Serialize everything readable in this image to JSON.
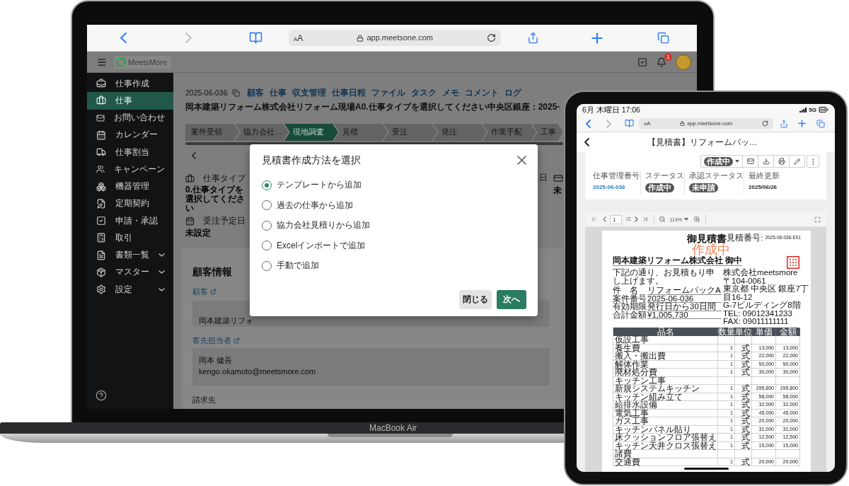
{
  "laptop": {
    "model_label": "MacBook Air",
    "browser": {
      "text_size": "AA",
      "url": "app.meetsone.com"
    },
    "app_header": {
      "logo": "MeetsMore",
      "notification_count": "1"
    },
    "sidebar": {
      "items": [
        {
          "label": "仕事作成",
          "selected": false,
          "expandable": false
        },
        {
          "label": "仕事",
          "selected": true,
          "expandable": false
        },
        {
          "label": "お問い合わせ",
          "selected": false,
          "expandable": false
        },
        {
          "label": "カレンダー",
          "selected": false,
          "expandable": false
        },
        {
          "label": "仕事割当",
          "selected": false,
          "expandable": false
        },
        {
          "label": "キャンペーン",
          "selected": false,
          "expandable": false
        },
        {
          "label": "機器管理",
          "selected": false,
          "expandable": false
        },
        {
          "label": "定期契約",
          "selected": false,
          "expandable": false
        },
        {
          "label": "申請・承認",
          "selected": false,
          "expandable": false
        },
        {
          "label": "取引",
          "selected": false,
          "expandable": false
        },
        {
          "label": "書類一覧",
          "selected": false,
          "expandable": true
        },
        {
          "label": "マスター",
          "selected": false,
          "expandable": true
        },
        {
          "label": "設定",
          "selected": false,
          "expandable": true
        }
      ]
    },
    "job": {
      "number": "2025-06-036",
      "links": [
        "顧客",
        "仕事",
        "収支管理",
        "仕事日程",
        "ファイル",
        "タスク",
        "メモ",
        "コメント",
        "ログ"
      ],
      "title": "岡本建築リフォーム株式会社リフォーム現場A0.仕事タイプを選択してください中央区銀座：2025-",
      "steps": [
        {
          "label": "案件受領",
          "selected": false
        },
        {
          "label": "協力会社…",
          "selected": false
        },
        {
          "label": "現地調査",
          "selected": true
        },
        {
          "label": "見積",
          "selected": false
        },
        {
          "label": "受注",
          "selected": false
        },
        {
          "label": "発注",
          "selected": false
        },
        {
          "label": "作業手配",
          "selected": false
        },
        {
          "label": "工事",
          "selected": false
        }
      ],
      "fields": [
        {
          "label": "仕事タイプ",
          "value": "0.仕事タイプを選択してください"
        },
        {
          "label": "受注予定日",
          "value": "未設定"
        }
      ],
      "column_3": {
        "label": "日"
      },
      "column_4": {
        "value": "未"
      }
    },
    "customer_panel": {
      "heading": "顧客情報",
      "customer_label": "顧客",
      "customer_value": "岡本建築リフォ",
      "contact_label": "客先担当者",
      "contact_name": "岡本 健吾",
      "contact_email": "kengo.okamoto@meetsmore.com",
      "billing_label": "請求先"
    },
    "dialog": {
      "title": "見積書作成方法を選択",
      "options": [
        {
          "label": "テンプレートから追加",
          "selected": true
        },
        {
          "label": "過去の仕事から追加",
          "selected": false
        },
        {
          "label": "協力会社見積りから追加",
          "selected": false
        },
        {
          "label": "Excelインポートで追加",
          "selected": false
        },
        {
          "label": "手動で追加",
          "selected": false
        }
      ],
      "buttons": [
        {
          "label": "閉じる",
          "kind": "secondary"
        },
        {
          "label": "次へ",
          "kind": "primary"
        }
      ]
    }
  },
  "tablet": {
    "status_bar": {
      "time": "6月 木曜日 17:06",
      "network": "5G"
    },
    "browser": {
      "text_size": "AA",
      "url": "app.meetsone.com"
    },
    "page_title": "【見積書】リフォームパッ…",
    "toolbar": {
      "status": "作成中"
    },
    "summary": [
      {
        "label": "仕事管理番号",
        "value": "2025-06-036",
        "kind": "link"
      },
      {
        "label": "ステータス",
        "value": "作成中",
        "kind": "badge"
      },
      {
        "label": "承認ステータス",
        "value": "未申請",
        "kind": "badge"
      },
      {
        "label": "最終更新",
        "value": "2025/06/26",
        "kind": "text"
      }
    ],
    "viewer": {
      "page": "1",
      "page_total": "/2",
      "zoom": "114%"
    },
    "document": {
      "number_label": "見積番号:",
      "number": "2025-06-036-E01",
      "title": "御見積書",
      "stamp": "作成中",
      "recipient": "岡本建築リフォーム株式会社 御中",
      "greeting": "下記の通り、お見積もり申し上げます。",
      "issuer": {
        "name": "株式会社meetsmore",
        "address": [
          "〒104-0061",
          "東京都 中央区 銀座7丁目16-12",
          "G-7ビルディング8階",
          "TEL: 09012341233",
          "FAX: 09011111111"
        ]
      },
      "details": [
        {
          "label": "件　名",
          "value": "リフォームパックA"
        },
        {
          "label": "案件番号",
          "value": "2025-06-036"
        },
        {
          "label": "有効期限",
          "value": "発行日から30日間"
        },
        {
          "label": "合計金額",
          "value": "¥1,005,730"
        }
      ],
      "table": {
        "columns": [
          "品名",
          "数量",
          "単位",
          "単価",
          "金額"
        ],
        "rows": [
          {
            "kind": "section",
            "cells": [
              "仮設工事"
            ]
          },
          {
            "kind": "item",
            "cells": [
              "養生費",
              "1",
              "式",
              "13,000",
              "13,000"
            ]
          },
          {
            "kind": "item",
            "cells": [
              "搬入・搬出費",
              "1",
              "式",
              "22,000",
              "22,000"
            ]
          },
          {
            "kind": "item",
            "cells": [
              "解体作業",
              "1",
              "式",
              "50,000",
              "50,000"
            ]
          },
          {
            "kind": "item",
            "cells": [
              "廃材処分費",
              "1",
              "式",
              "30,000",
              "30,000"
            ]
          },
          {
            "kind": "section",
            "cells": [
              "キッチン工事"
            ]
          },
          {
            "kind": "item",
            "cells": [
              "新規システムキッチン",
              "1",
              "式",
              "295,800",
              "295,800"
            ]
          },
          {
            "kind": "item",
            "cells": [
              "キッチン組み立て",
              "1",
              "式",
              "58,000",
              "58,000"
            ]
          },
          {
            "kind": "item",
            "cells": [
              "給排水設備",
              "1",
              "式",
              "32,000",
              "32,000"
            ]
          },
          {
            "kind": "item",
            "cells": [
              "電気工事",
              "1",
              "式",
              "45,000",
              "45,000"
            ]
          },
          {
            "kind": "item",
            "cells": [
              "ガス工事",
              "1",
              "式",
              "20,000",
              "20,000"
            ]
          },
          {
            "kind": "item",
            "cells": [
              "キッチンパネル貼り",
              "1",
              "式",
              "31,000",
              "31,000"
            ]
          },
          {
            "kind": "item",
            "cells": [
              "床クッションフロア張替え",
              "1",
              "式",
              "12,500",
              "12,500"
            ]
          },
          {
            "kind": "item",
            "cells": [
              "キッチン天井クロス張替え",
              "1",
              "式",
              "15,000",
              "15,000"
            ]
          },
          {
            "kind": "section",
            "cells": [
              "諸費"
            ]
          },
          {
            "kind": "item",
            "cells": [
              "交通費",
              "1",
              "式",
              "20,000",
              "20,000"
            ]
          }
        ]
      }
    }
  }
}
